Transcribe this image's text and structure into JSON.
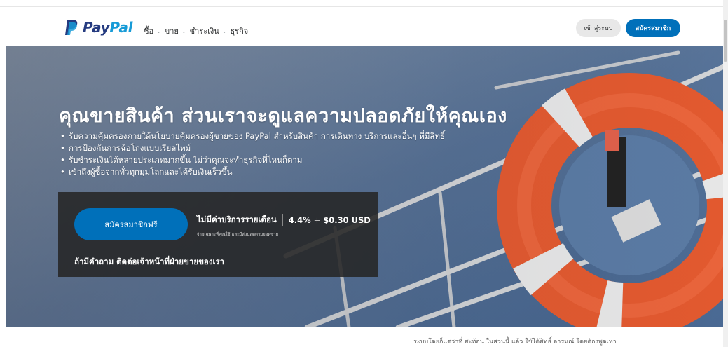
{
  "header": {
    "logo_text_1": "Pay",
    "logo_text_2": "Pal",
    "nav": [
      {
        "label": "ซื้อ"
      },
      {
        "label": "ขาย"
      },
      {
        "label": "ชำระเงิน"
      },
      {
        "label": "ธุรกิจ"
      }
    ],
    "chevron_glyph": "⌄",
    "login_label": "เข้าสู่ระบบ",
    "signup_label": "สมัครสมาชิก"
  },
  "hero": {
    "title": "คุณขายสินค้า ส่วนเราจะดูแลความปลอดภัยให้คุณเอง",
    "bullets": [
      "รับความคุ้มครองภายใต้นโยบายคุ้มครองผู้ขายของ PayPal สำหรับสินค้า การเดินทาง บริการและอื่นๆ ที่มีสิทธิ์",
      "การป้องกันการฉ้อโกงแบบเรียลไทม์",
      "รับชำระเงินได้หลายประเภทมากขึ้น ไม่ว่าคุณจะทำธุรกิจที่ไหนก็ตาม",
      "เข้าถึงผู้ซื้อจากทั่วทุกมุมโลกและได้รับเงินเร็วขึ้น"
    ],
    "cta_label": "สมัครสมาชิกฟรี",
    "fee_label": "ไม่มีค่าบริการรายเดือน",
    "fee_value": "4.4%",
    "fee_plus": "+",
    "fee_fixed": "$0.30 USD",
    "fee_note": "จ่ายเฉพาะที่คุณใช้ และมีส่วนลดตามยอดขาย",
    "contact_text": "ถ้ามีคำถาม ติดต่อเจ้าหน้าที่ฝ่ายขายของเรา"
  },
  "footer_partial_text": "ระบบโดยก็แต่ว่าที่ สะท้อน ในส่วนนี้ แล้ว ใช้ได้สิทธิ์ อารมณ์ โดยต้องพูดเท่า",
  "colors": {
    "brand_dark": "#253b80",
    "brand_light": "#179bd7",
    "button_blue": "#0070ba",
    "lifebuoy": "#e2592f"
  }
}
